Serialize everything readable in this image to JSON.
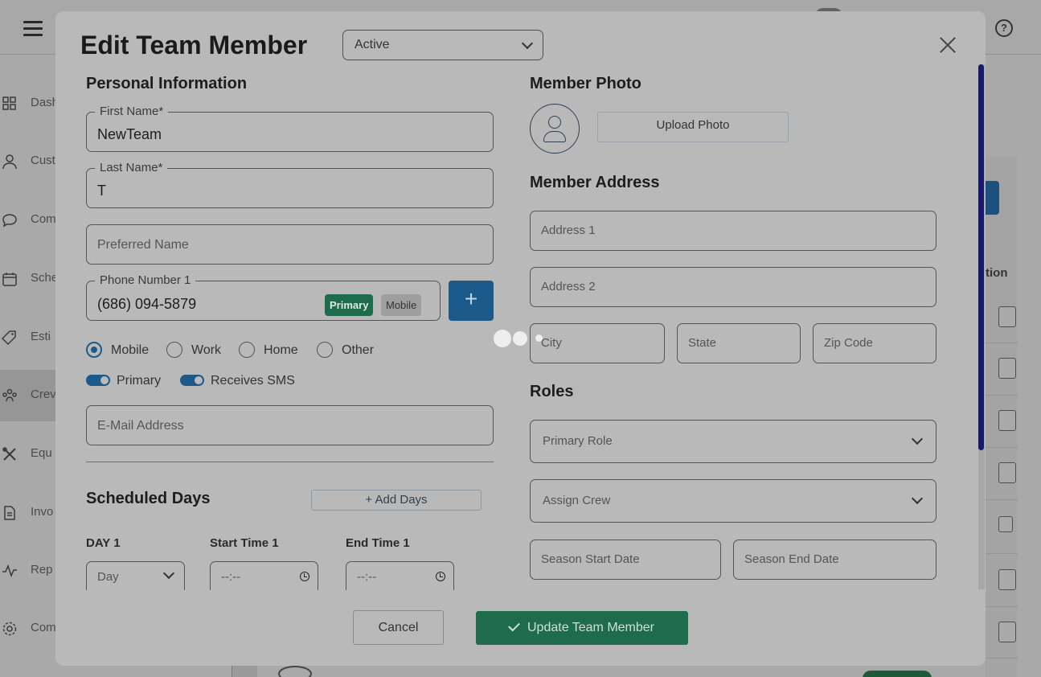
{
  "background": {
    "sidebar": [
      {
        "label": "Dash",
        "icon": "dashboard-icon"
      },
      {
        "label": "Cust",
        "icon": "user-icon"
      },
      {
        "label": "Com",
        "icon": "chat-icon"
      },
      {
        "label": "Sche",
        "icon": "calendar-icon"
      },
      {
        "label": "Esti",
        "icon": "tag-icon"
      },
      {
        "label": "Crev",
        "icon": "crew-icon"
      },
      {
        "label": "Equ",
        "icon": "tools-icon"
      },
      {
        "label": "Invo",
        "icon": "invoice-icon"
      },
      {
        "label": "Rep",
        "icon": "report-icon"
      },
      {
        "label": "Com",
        "icon": "gear-icon"
      }
    ],
    "table_header_fragment": "tion",
    "help_icon": "?"
  },
  "modal": {
    "title": "Edit Team Member",
    "status": "Active",
    "personal": {
      "heading": "Personal Information",
      "first_name_label": "First Name*",
      "first_name": "NewTeam",
      "last_name_label": "Last Name*",
      "last_name": "T",
      "preferred_name_placeholder": "Preferred Name",
      "phone_label": "Phone Number 1",
      "phone": "(686) 094-5879",
      "phone_tag_primary": "Primary",
      "phone_tag_type": "Mobile",
      "add_phone": "+",
      "phone_types": [
        "Mobile",
        "Work",
        "Home",
        "Other"
      ],
      "selected_phone_type": "Mobile",
      "toggle_primary": "Primary",
      "toggle_sms": "Receives SMS",
      "email_placeholder": "E-Mail Address"
    },
    "schedule": {
      "heading": "Scheduled Days",
      "add_days": "+ Add Days",
      "day_label": "DAY 1",
      "start_label": "Start Time 1",
      "end_label": "End Time 1",
      "day_placeholder": "Day",
      "time_placeholder": "--:--"
    },
    "photo": {
      "heading": "Member Photo",
      "upload": "Upload Photo"
    },
    "address": {
      "heading": "Member Address",
      "address1": "Address 1",
      "address2": "Address 2",
      "city": "City",
      "state": "State",
      "zip": "Zip Code"
    },
    "roles": {
      "heading": "Roles",
      "primary_role": "Primary Role",
      "assign_crew": "Assign Crew",
      "season_start": "Season Start Date",
      "season_end": "Season End Date"
    },
    "footer": {
      "cancel": "Cancel",
      "update": "Update Team Member"
    }
  },
  "colors": {
    "accent_blue": "#1d5a8c",
    "accent_green": "#1e6b4d",
    "scroll_thumb": "#181a6e"
  }
}
